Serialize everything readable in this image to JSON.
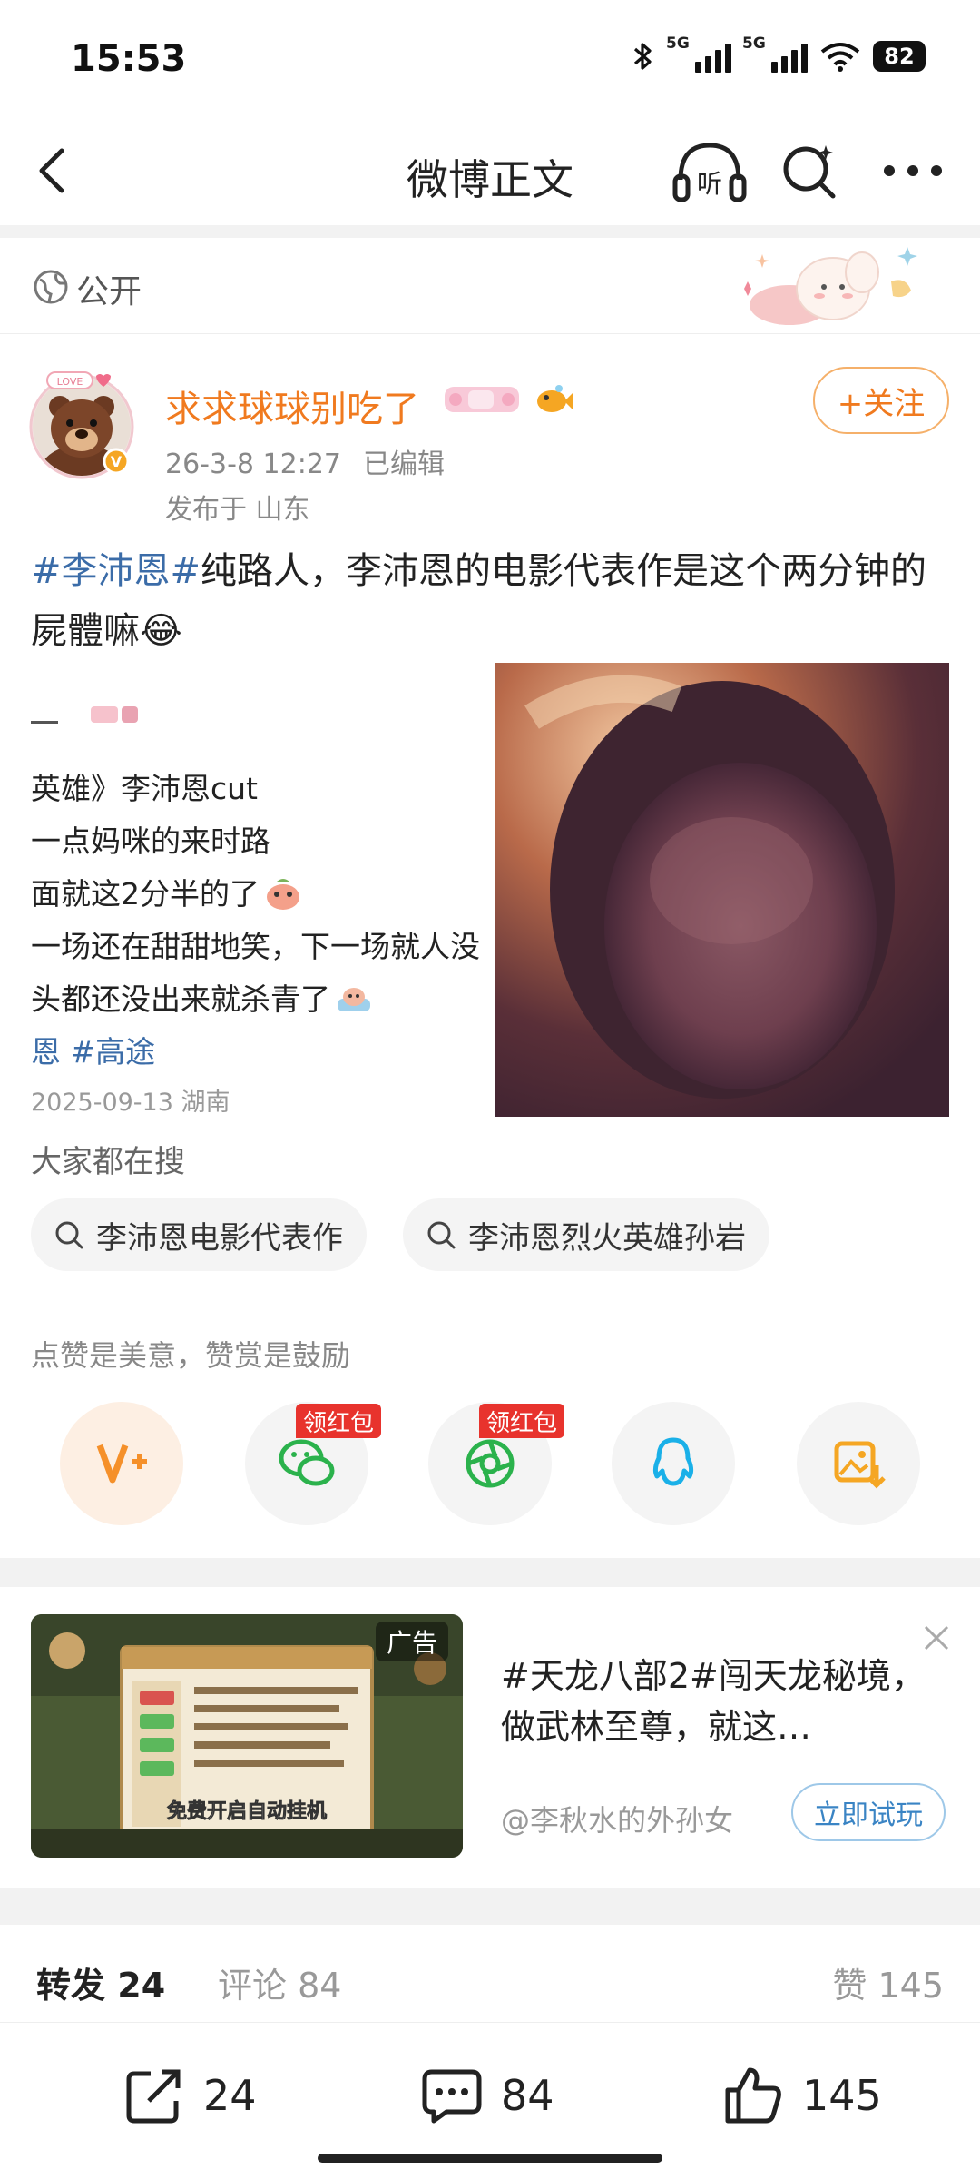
{
  "status_bar": {
    "time": "15:53",
    "network_1": "5G",
    "network_2": "5G",
    "battery": "82"
  },
  "nav": {
    "title": "微博正文",
    "listen_label": "听"
  },
  "visibility": {
    "label": "公开"
  },
  "author": {
    "name": "求求球球别吃了",
    "avatar_badge": "LOVE",
    "follow_label": "+关注",
    "date": "26-3-8 12:27",
    "edited": "已编辑",
    "location": "发布于 山东"
  },
  "post": {
    "hashtag": "#李沛恩#",
    "text": "纯路人，李沛恩的电影代表作是这个两分钟的屍體嘛😂"
  },
  "embedded_screenshot": {
    "lines": [
      "英雄》李沛恩cut",
      "一点妈咪的来时路",
      "面就这2分半的了",
      "一场还在甜甜地笑，下一场就人没",
      "头都还没出来就杀青了"
    ],
    "tag_prefix": "恩",
    "tag": "#高途",
    "date": "2025-09-13 湖南"
  },
  "searches": {
    "label": "大家都在搜",
    "items": [
      "李沛恩电影代表作",
      "李沛恩烈火英雄孙岩"
    ]
  },
  "appreciation": {
    "label": "点赞是美意，赞赏是鼓励",
    "red_packet_label": "领红包",
    "share_icons": [
      "vplus-icon",
      "wechat-icon",
      "moments-icon",
      "qq-icon",
      "save-image-icon"
    ]
  },
  "ad": {
    "tag": "广告",
    "title": "#天龙八部2#闯天龙秘境，做武林至尊，就这…",
    "source": "@李秋水的外孙女",
    "cta": "立即试玩",
    "thumb_caption": "免费开启自动挂机"
  },
  "counts": {
    "repost_label": "转发",
    "repost_count": "24",
    "comment_label": "评论",
    "comment_count": "84",
    "like_label": "赞",
    "like_count": "145"
  },
  "bottom_bar": {
    "repost": "24",
    "comment": "84",
    "like": "145"
  },
  "colors": {
    "accent_orange": "#f07a1f",
    "link_blue": "#3b6ca8",
    "red_packet": "#e8332d"
  }
}
